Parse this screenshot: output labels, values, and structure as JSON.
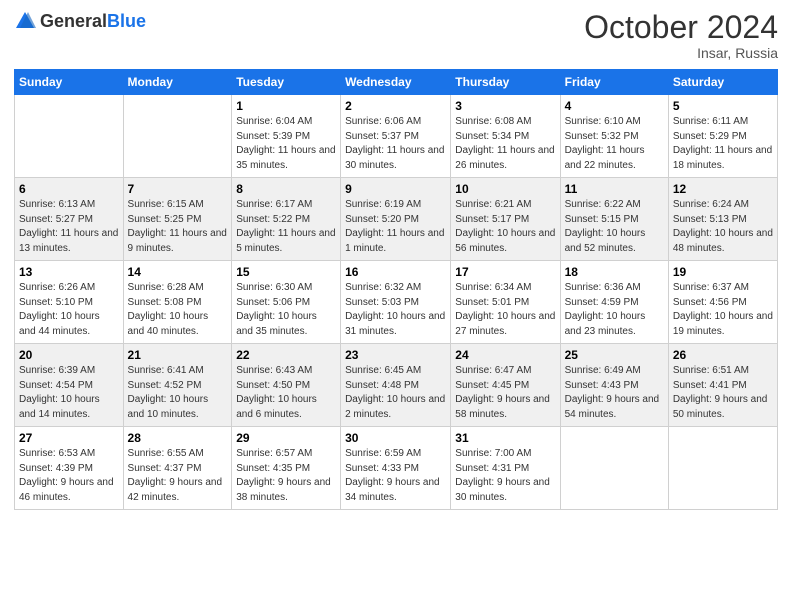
{
  "header": {
    "logo_general": "General",
    "logo_blue": "Blue",
    "month_title": "October 2024",
    "location": "Insar, Russia"
  },
  "weekdays": [
    "Sunday",
    "Monday",
    "Tuesday",
    "Wednesday",
    "Thursday",
    "Friday",
    "Saturday"
  ],
  "weeks": [
    [
      {
        "day": "",
        "sunrise": "",
        "sunset": "",
        "daylight": ""
      },
      {
        "day": "",
        "sunrise": "",
        "sunset": "",
        "daylight": ""
      },
      {
        "day": "1",
        "sunrise": "Sunrise: 6:04 AM",
        "sunset": "Sunset: 5:39 PM",
        "daylight": "Daylight: 11 hours and 35 minutes."
      },
      {
        "day": "2",
        "sunrise": "Sunrise: 6:06 AM",
        "sunset": "Sunset: 5:37 PM",
        "daylight": "Daylight: 11 hours and 30 minutes."
      },
      {
        "day": "3",
        "sunrise": "Sunrise: 6:08 AM",
        "sunset": "Sunset: 5:34 PM",
        "daylight": "Daylight: 11 hours and 26 minutes."
      },
      {
        "day": "4",
        "sunrise": "Sunrise: 6:10 AM",
        "sunset": "Sunset: 5:32 PM",
        "daylight": "Daylight: 11 hours and 22 minutes."
      },
      {
        "day": "5",
        "sunrise": "Sunrise: 6:11 AM",
        "sunset": "Sunset: 5:29 PM",
        "daylight": "Daylight: 11 hours and 18 minutes."
      }
    ],
    [
      {
        "day": "6",
        "sunrise": "Sunrise: 6:13 AM",
        "sunset": "Sunset: 5:27 PM",
        "daylight": "Daylight: 11 hours and 13 minutes."
      },
      {
        "day": "7",
        "sunrise": "Sunrise: 6:15 AM",
        "sunset": "Sunset: 5:25 PM",
        "daylight": "Daylight: 11 hours and 9 minutes."
      },
      {
        "day": "8",
        "sunrise": "Sunrise: 6:17 AM",
        "sunset": "Sunset: 5:22 PM",
        "daylight": "Daylight: 11 hours and 5 minutes."
      },
      {
        "day": "9",
        "sunrise": "Sunrise: 6:19 AM",
        "sunset": "Sunset: 5:20 PM",
        "daylight": "Daylight: 11 hours and 1 minute."
      },
      {
        "day": "10",
        "sunrise": "Sunrise: 6:21 AM",
        "sunset": "Sunset: 5:17 PM",
        "daylight": "Daylight: 10 hours and 56 minutes."
      },
      {
        "day": "11",
        "sunrise": "Sunrise: 6:22 AM",
        "sunset": "Sunset: 5:15 PM",
        "daylight": "Daylight: 10 hours and 52 minutes."
      },
      {
        "day": "12",
        "sunrise": "Sunrise: 6:24 AM",
        "sunset": "Sunset: 5:13 PM",
        "daylight": "Daylight: 10 hours and 48 minutes."
      }
    ],
    [
      {
        "day": "13",
        "sunrise": "Sunrise: 6:26 AM",
        "sunset": "Sunset: 5:10 PM",
        "daylight": "Daylight: 10 hours and 44 minutes."
      },
      {
        "day": "14",
        "sunrise": "Sunrise: 6:28 AM",
        "sunset": "Sunset: 5:08 PM",
        "daylight": "Daylight: 10 hours and 40 minutes."
      },
      {
        "day": "15",
        "sunrise": "Sunrise: 6:30 AM",
        "sunset": "Sunset: 5:06 PM",
        "daylight": "Daylight: 10 hours and 35 minutes."
      },
      {
        "day": "16",
        "sunrise": "Sunrise: 6:32 AM",
        "sunset": "Sunset: 5:03 PM",
        "daylight": "Daylight: 10 hours and 31 minutes."
      },
      {
        "day": "17",
        "sunrise": "Sunrise: 6:34 AM",
        "sunset": "Sunset: 5:01 PM",
        "daylight": "Daylight: 10 hours and 27 minutes."
      },
      {
        "day": "18",
        "sunrise": "Sunrise: 6:36 AM",
        "sunset": "Sunset: 4:59 PM",
        "daylight": "Daylight: 10 hours and 23 minutes."
      },
      {
        "day": "19",
        "sunrise": "Sunrise: 6:37 AM",
        "sunset": "Sunset: 4:56 PM",
        "daylight": "Daylight: 10 hours and 19 minutes."
      }
    ],
    [
      {
        "day": "20",
        "sunrise": "Sunrise: 6:39 AM",
        "sunset": "Sunset: 4:54 PM",
        "daylight": "Daylight: 10 hours and 14 minutes."
      },
      {
        "day": "21",
        "sunrise": "Sunrise: 6:41 AM",
        "sunset": "Sunset: 4:52 PM",
        "daylight": "Daylight: 10 hours and 10 minutes."
      },
      {
        "day": "22",
        "sunrise": "Sunrise: 6:43 AM",
        "sunset": "Sunset: 4:50 PM",
        "daylight": "Daylight: 10 hours and 6 minutes."
      },
      {
        "day": "23",
        "sunrise": "Sunrise: 6:45 AM",
        "sunset": "Sunset: 4:48 PM",
        "daylight": "Daylight: 10 hours and 2 minutes."
      },
      {
        "day": "24",
        "sunrise": "Sunrise: 6:47 AM",
        "sunset": "Sunset: 4:45 PM",
        "daylight": "Daylight: 9 hours and 58 minutes."
      },
      {
        "day": "25",
        "sunrise": "Sunrise: 6:49 AM",
        "sunset": "Sunset: 4:43 PM",
        "daylight": "Daylight: 9 hours and 54 minutes."
      },
      {
        "day": "26",
        "sunrise": "Sunrise: 6:51 AM",
        "sunset": "Sunset: 4:41 PM",
        "daylight": "Daylight: 9 hours and 50 minutes."
      }
    ],
    [
      {
        "day": "27",
        "sunrise": "Sunrise: 6:53 AM",
        "sunset": "Sunset: 4:39 PM",
        "daylight": "Daylight: 9 hours and 46 minutes."
      },
      {
        "day": "28",
        "sunrise": "Sunrise: 6:55 AM",
        "sunset": "Sunset: 4:37 PM",
        "daylight": "Daylight: 9 hours and 42 minutes."
      },
      {
        "day": "29",
        "sunrise": "Sunrise: 6:57 AM",
        "sunset": "Sunset: 4:35 PM",
        "daylight": "Daylight: 9 hours and 38 minutes."
      },
      {
        "day": "30",
        "sunrise": "Sunrise: 6:59 AM",
        "sunset": "Sunset: 4:33 PM",
        "daylight": "Daylight: 9 hours and 34 minutes."
      },
      {
        "day": "31",
        "sunrise": "Sunrise: 7:00 AM",
        "sunset": "Sunset: 4:31 PM",
        "daylight": "Daylight: 9 hours and 30 minutes."
      },
      {
        "day": "",
        "sunrise": "",
        "sunset": "",
        "daylight": ""
      },
      {
        "day": "",
        "sunrise": "",
        "sunset": "",
        "daylight": ""
      }
    ]
  ]
}
